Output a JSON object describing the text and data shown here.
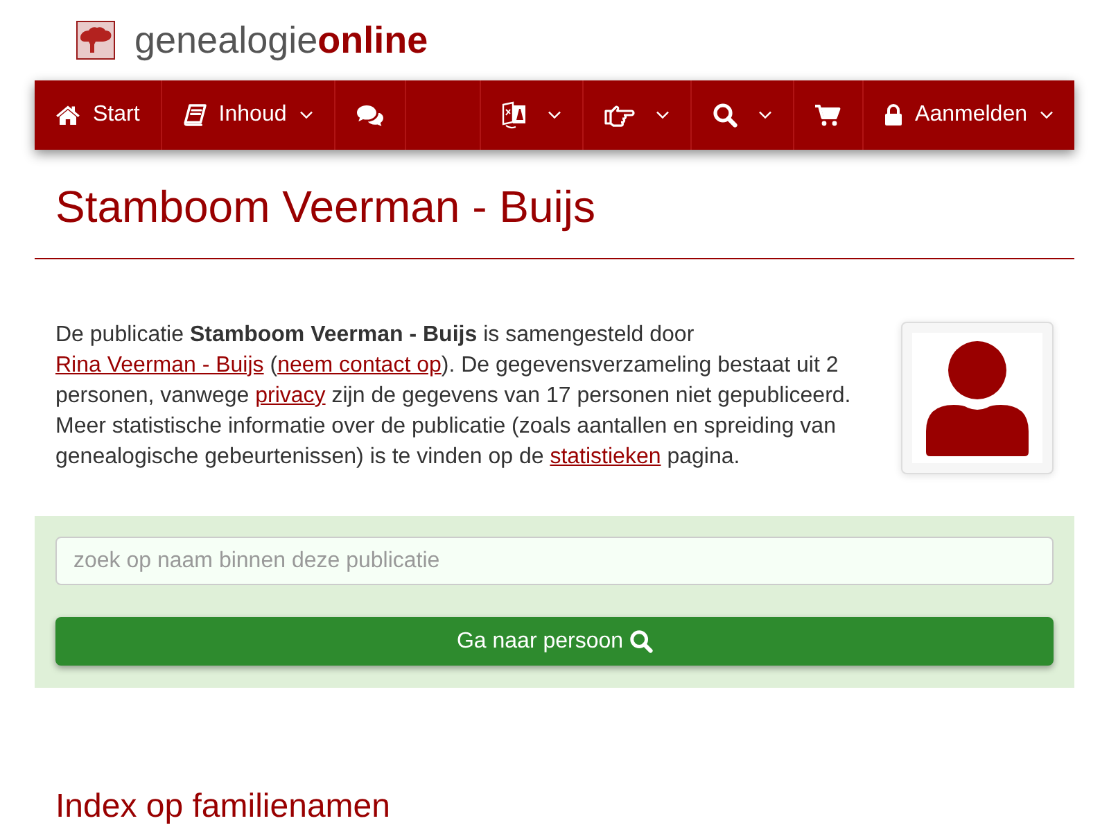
{
  "logo": {
    "text": "genealogie**online**"
  },
  "nav": {
    "left": [
      {
        "label": "Start",
        "dropdown": false
      },
      {
        "label": "Inhoud",
        "dropdown": true
      },
      {
        "dropdown": false
      }
    ],
    "right": [
      {
        "dropdown": true
      },
      {
        "dropdown": true
      },
      {
        "dropdown": true
      },
      {
        "dropdown": false
      },
      {
        "label": "Aanmelden",
        "dropdown": true
      }
    ]
  },
  "page": {
    "title": "Stamboom Veerman - Buijs",
    "intro": [
      {
        "kind": "text",
        "text": "De publicatie **Stamboom Veerman - Buijs** is samengesteld door "
      },
      {
        "kind": "link",
        "text": "Rina Veerman - Buijs"
      },
      {
        "kind": "text",
        "text": " ("
      },
      {
        "kind": "link",
        "text": "neem contact op"
      },
      {
        "kind": "text",
        "text": "). De gegevensverzameling bestaat uit 2 personen, vanwege "
      },
      {
        "kind": "link",
        "text": "privacy"
      },
      {
        "kind": "text",
        "text": " zijn de gegevens van 17 personen niet gepubliceerd. Meer statistische informatie over de publicatie (zoals aantallen en spreiding van genealogische gebeurtenissen) is te vinden op de "
      },
      {
        "kind": "link",
        "text": "statistieken"
      },
      {
        "kind": "text",
        "text": " pagina."
      }
    ]
  },
  "search": {
    "placeholder": "zoek op naam binnen deze publicatie",
    "button": "Ga naar persoon"
  },
  "sections": [
    {
      "heading": "Index op familienamen"
    }
  ]
}
